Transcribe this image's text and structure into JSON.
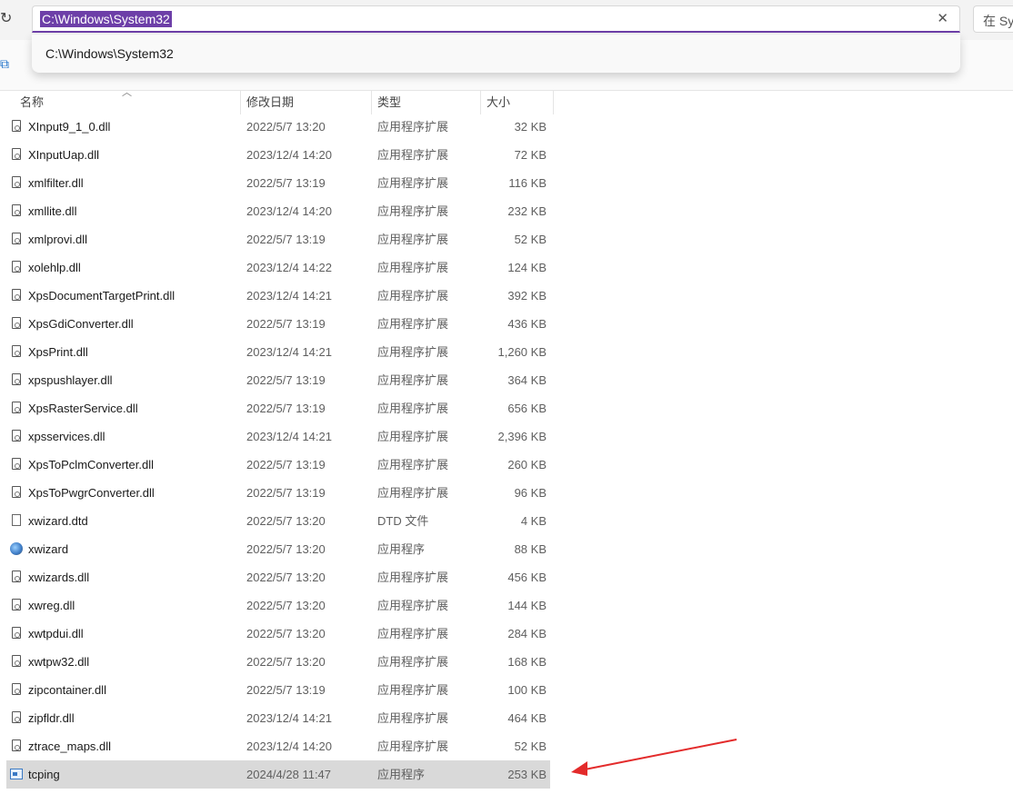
{
  "address": {
    "value": "C:\\Windows\\System32",
    "suggestion": "C:\\Windows\\System32",
    "clear_icon": "✕"
  },
  "search": {
    "label": "在 Sys"
  },
  "columns": {
    "name": "名称",
    "date": "修改日期",
    "type": "类型",
    "size": "大小"
  },
  "files": [
    {
      "name": "XInput9_1_0.dll",
      "date": "2022/5/7 13:20",
      "type": "应用程序扩展",
      "size": "32 KB",
      "icon": "dll-icon"
    },
    {
      "name": "XInputUap.dll",
      "date": "2023/12/4 14:20",
      "type": "应用程序扩展",
      "size": "72 KB",
      "icon": "dll-icon"
    },
    {
      "name": "xmlfilter.dll",
      "date": "2022/5/7 13:19",
      "type": "应用程序扩展",
      "size": "116 KB",
      "icon": "dll-icon"
    },
    {
      "name": "xmllite.dll",
      "date": "2023/12/4 14:20",
      "type": "应用程序扩展",
      "size": "232 KB",
      "icon": "dll-icon"
    },
    {
      "name": "xmlprovi.dll",
      "date": "2022/5/7 13:19",
      "type": "应用程序扩展",
      "size": "52 KB",
      "icon": "dll-icon"
    },
    {
      "name": "xolehlp.dll",
      "date": "2023/12/4 14:22",
      "type": "应用程序扩展",
      "size": "124 KB",
      "icon": "dll-icon"
    },
    {
      "name": "XpsDocumentTargetPrint.dll",
      "date": "2023/12/4 14:21",
      "type": "应用程序扩展",
      "size": "392 KB",
      "icon": "dll-icon"
    },
    {
      "name": "XpsGdiConverter.dll",
      "date": "2022/5/7 13:19",
      "type": "应用程序扩展",
      "size": "436 KB",
      "icon": "dll-icon"
    },
    {
      "name": "XpsPrint.dll",
      "date": "2023/12/4 14:21",
      "type": "应用程序扩展",
      "size": "1,260 KB",
      "icon": "dll-icon"
    },
    {
      "name": "xpspushlayer.dll",
      "date": "2022/5/7 13:19",
      "type": "应用程序扩展",
      "size": "364 KB",
      "icon": "dll-icon"
    },
    {
      "name": "XpsRasterService.dll",
      "date": "2022/5/7 13:19",
      "type": "应用程序扩展",
      "size": "656 KB",
      "icon": "dll-icon"
    },
    {
      "name": "xpsservices.dll",
      "date": "2023/12/4 14:21",
      "type": "应用程序扩展",
      "size": "2,396 KB",
      "icon": "dll-icon"
    },
    {
      "name": "XpsToPclmConverter.dll",
      "date": "2022/5/7 13:19",
      "type": "应用程序扩展",
      "size": "260 KB",
      "icon": "dll-icon"
    },
    {
      "name": "XpsToPwgrConverter.dll",
      "date": "2022/5/7 13:19",
      "type": "应用程序扩展",
      "size": "96 KB",
      "icon": "dll-icon"
    },
    {
      "name": "xwizard.dtd",
      "date": "2022/5/7 13:20",
      "type": "DTD 文件",
      "size": "4 KB",
      "icon": "file-icon"
    },
    {
      "name": "xwizard",
      "date": "2022/5/7 13:20",
      "type": "应用程序",
      "size": "88 KB",
      "icon": "app-icon"
    },
    {
      "name": "xwizards.dll",
      "date": "2022/5/7 13:20",
      "type": "应用程序扩展",
      "size": "456 KB",
      "icon": "dll-icon"
    },
    {
      "name": "xwreg.dll",
      "date": "2022/5/7 13:20",
      "type": "应用程序扩展",
      "size": "144 KB",
      "icon": "dll-icon"
    },
    {
      "name": "xwtpdui.dll",
      "date": "2022/5/7 13:20",
      "type": "应用程序扩展",
      "size": "284 KB",
      "icon": "dll-icon"
    },
    {
      "name": "xwtpw32.dll",
      "date": "2022/5/7 13:20",
      "type": "应用程序扩展",
      "size": "168 KB",
      "icon": "dll-icon"
    },
    {
      "name": "zipcontainer.dll",
      "date": "2022/5/7 13:19",
      "type": "应用程序扩展",
      "size": "100 KB",
      "icon": "dll-icon"
    },
    {
      "name": "zipfldr.dll",
      "date": "2023/12/4 14:21",
      "type": "应用程序扩展",
      "size": "464 KB",
      "icon": "dll-icon"
    },
    {
      "name": "ztrace_maps.dll",
      "date": "2023/12/4 14:20",
      "type": "应用程序扩展",
      "size": "52 KB",
      "icon": "dll-icon"
    },
    {
      "name": "tcping",
      "date": "2024/4/28 11:47",
      "type": "应用程序",
      "size": "253 KB",
      "icon": "exe-icon",
      "selected": true
    }
  ],
  "colors": {
    "accent": "#6d3fa8",
    "selected_row": "#d9d9d9",
    "arrow": "#e32b2b"
  }
}
